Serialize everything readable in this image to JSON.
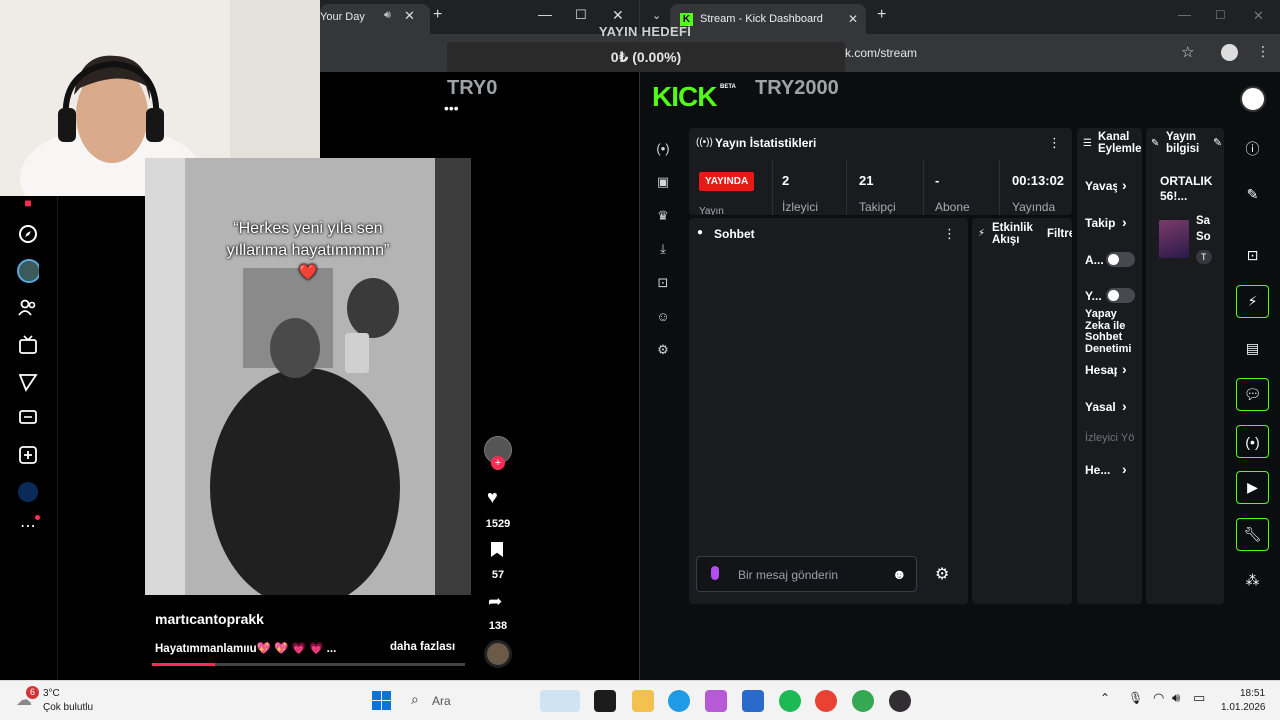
{
  "left_window": {
    "tab_title": "Your Day",
    "tiktok": {
      "video_caption_line1": "“Herkes yeni yıla sen",
      "video_caption_line2": "yıllarıma hayatımmmn”",
      "heart_emoji": "❤️",
      "username": "martıcantoprakk",
      "description": "Hayatımmanlamııu💖 💖 💗 💗 ...",
      "more_label": "daha fazlası",
      "likes": "1529",
      "bookmarks": "57",
      "shares": "138",
      "progress": 0.2
    }
  },
  "overlay": {
    "goal_title": "YAYIN HEDEFİ",
    "goal_value": "0₺ (0.00%)",
    "try_left": "TRY0",
    "try_right": "TRY2000"
  },
  "right_window": {
    "tab_title": "Stream - Kick Dashboard",
    "url": "k.com/stream",
    "logo": "KICK",
    "logo_sup": "BETA",
    "stats_panel": {
      "title": "Yayın İstatistikleri",
      "live_badge": "YAYINDA",
      "live_sub": "Yayın",
      "stats": [
        {
          "value": "2",
          "label": "İzleyici"
        },
        {
          "value": "21",
          "label": "Takipçi"
        },
        {
          "value": "-",
          "label": "Abone"
        },
        {
          "value": "00:13:02",
          "label": "Yayında"
        }
      ]
    },
    "chat": {
      "title": "Sohbet",
      "placeholder": "Bir mesaj gönderin"
    },
    "activity": {
      "title_line1": "Etkinlik",
      "title_line2": "Akışı",
      "filter": "Filtre"
    },
    "channel_actions": {
      "title_line1": "Kanal",
      "title_line2": "Eylemler",
      "items": [
        {
          "label": "Yavaş",
          "type": "arrow"
        },
        {
          "label": "Takip",
          "type": "arrow"
        },
        {
          "label": "A...",
          "type": "toggle"
        },
        {
          "label": "Y...",
          "type": "toggle"
        },
        {
          "label": "Yapay Zeka ile Sohbet Denetimi",
          "type": "text"
        },
        {
          "label": "Hesap",
          "type": "arrow"
        },
        {
          "label": "Yasal",
          "type": "arrow"
        },
        {
          "label": "İzleyici Yö",
          "type": "muted"
        },
        {
          "label": "He...",
          "type": "arrow"
        }
      ]
    },
    "stream_info": {
      "title_line1": "Yayın",
      "title_line2": "bilgisi",
      "stream_title": "ORTALIK 56!...",
      "category_line1": "Sa",
      "category_line2": "So",
      "tag": "T"
    }
  },
  "taskbar": {
    "weather_temp": "3°C",
    "weather_desc": "Çok bulutlu",
    "weather_badge": "6",
    "search": "Ara",
    "time": "18:51",
    "date": "1.01.2026"
  },
  "colors": {
    "kick_green": "#53fc18",
    "live_red": "#e91916",
    "panel_bg": "#191b1f"
  }
}
